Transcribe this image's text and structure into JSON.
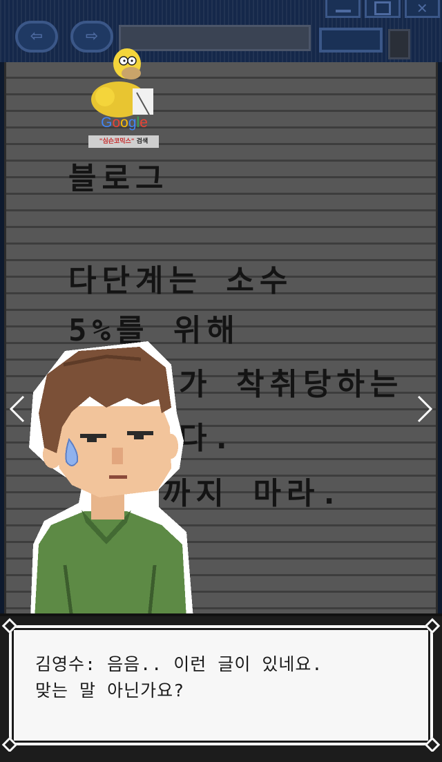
{
  "page": {
    "title": "블로그",
    "lines": [
      "다단계는 소수",
      "5%를 위해",
      "가 착취당하는",
      "다.",
      "까지 마라."
    ]
  },
  "watermark": {
    "google_letters": [
      "G",
      "o",
      "o",
      "g",
      "l",
      "e"
    ],
    "google_colors": [
      "#4285f4",
      "#ea4335",
      "#fbbc05",
      "#4285f4",
      "#34a853",
      "#ea4335"
    ],
    "search_query": "\"심슨코믹스\"",
    "search_suffix": "검색"
  },
  "dialogue": {
    "speaker": "김영수",
    "line1": "음음.. 이런 글이 있네요.",
    "line2": "맞는 말 아닌가요?"
  },
  "icons": {
    "prev": "chevron-left-icon",
    "next": "chevron-right-icon",
    "back": "back-arrow-icon",
    "forward": "forward-arrow-icon",
    "minimize": "minimize-icon",
    "maximize": "maximize-icon",
    "close": "close-icon"
  }
}
